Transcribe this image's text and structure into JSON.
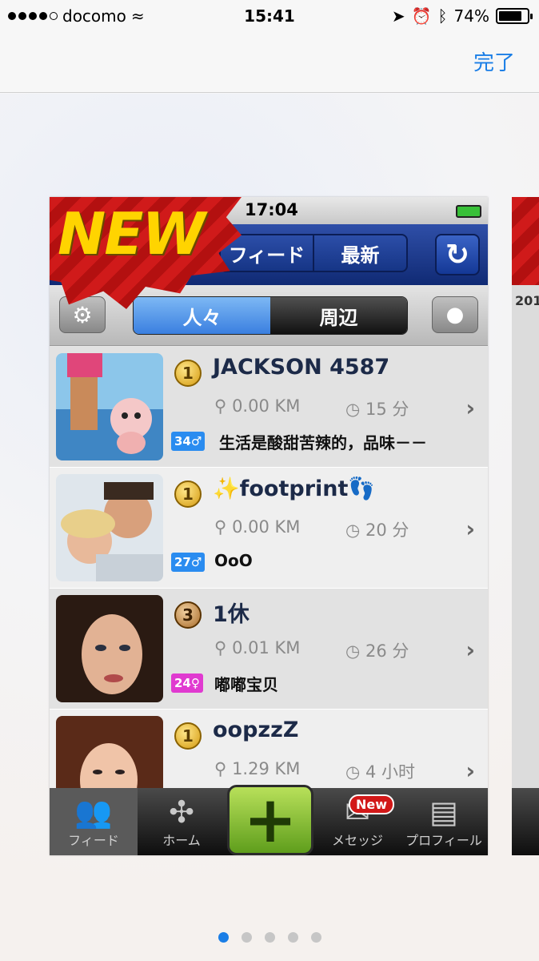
{
  "ios_status": {
    "carrier": "docomo",
    "time": "15:41",
    "battery": "74%",
    "battery_level": 0.74
  },
  "nav": {
    "done_label": "完了"
  },
  "app": {
    "status_time": "17:04",
    "banner": "NEW",
    "header_tabs": [
      "フィード",
      "最新"
    ],
    "refresh_icon": "refresh-icon",
    "filter_tabs": [
      "人々",
      "周辺"
    ],
    "active_filter": "人々",
    "users": [
      {
        "rank": "1",
        "name": "JACKSON 4587",
        "distance": "0.00 KM",
        "time_ago": "15 分",
        "age_badge": "34♂",
        "gender": "male",
        "message": "生活是酸甜苦辣的，品味－－",
        "rank_color": "#d49a10"
      },
      {
        "rank": "1",
        "name": "✨footprint👣",
        "distance": "0.00 KM",
        "time_ago": "20 分",
        "age_badge": "27♂",
        "gender": "male",
        "message": "OoO",
        "rank_color": "#d49a10"
      },
      {
        "rank": "3",
        "name": "1休",
        "distance": "0.01 KM",
        "time_ago": "26 分",
        "age_badge": "24♀",
        "gender": "female",
        "message": "嘟嘟宝贝",
        "rank_color": "#a86b2a"
      },
      {
        "rank": "1",
        "name": "oopzzZ",
        "distance": "1.29 KM",
        "time_ago": "4 小时",
        "age_badge": "",
        "gender": "",
        "message": "",
        "rank_color": "#d49a10"
      }
    ],
    "tabbar": [
      {
        "label": "フィード",
        "icon": "people-icon"
      },
      {
        "label": "ホーム",
        "icon": "puzzle-icon"
      },
      {
        "label": "",
        "icon": "plus-icon"
      },
      {
        "label": "メセッジ",
        "icon": "mail-icon",
        "badge": "New"
      },
      {
        "label": "プロフィール",
        "icon": "profile-card-icon"
      }
    ]
  },
  "peek_card": {
    "label": "201"
  },
  "page_indicator": {
    "count": 5,
    "active_index": 0
  }
}
